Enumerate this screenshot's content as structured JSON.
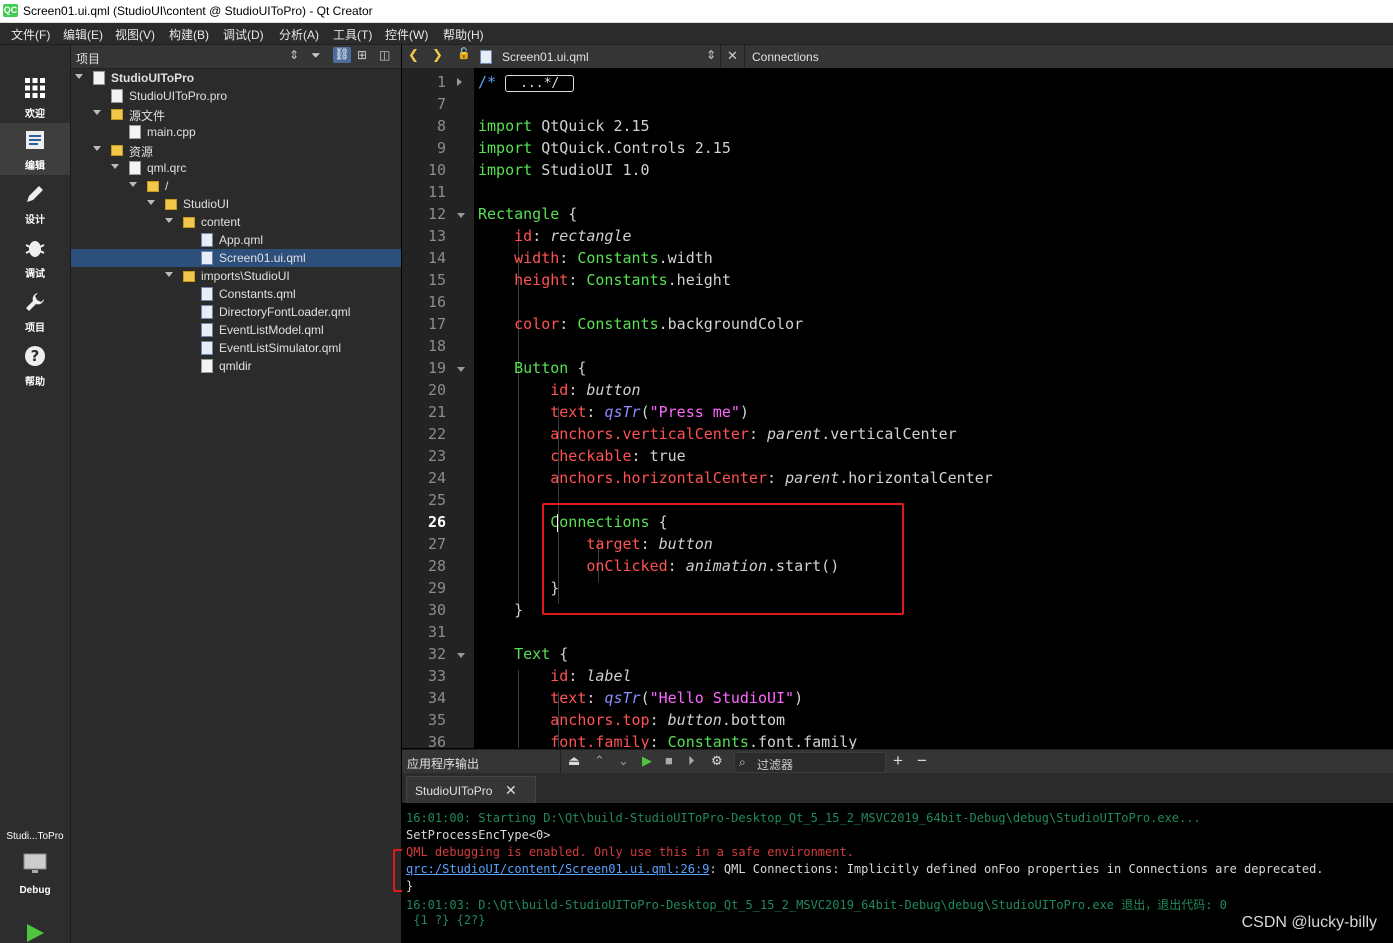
{
  "window": {
    "title": "Screen01.ui.qml (StudioUI\\content @ StudioUIToPro) - Qt Creator",
    "logo": "QC"
  },
  "menu": [
    "文件(F)",
    "编辑(E)",
    "视图(V)",
    "构建(B)",
    "调试(D)",
    "分析(A)",
    "工具(T)",
    "控件(W)",
    "帮助(H)"
  ],
  "modes": [
    {
      "label": "欢迎",
      "icon": "grid-icon"
    },
    {
      "label": "编辑",
      "icon": "edit-doc-icon"
    },
    {
      "label": "设计",
      "icon": "pencil-icon"
    },
    {
      "label": "调试",
      "icon": "bug-icon"
    },
    {
      "label": "项目",
      "icon": "wrench-icon"
    },
    {
      "label": "帮助",
      "icon": "help-icon"
    }
  ],
  "kit": {
    "project": "Studi...ToPro",
    "config": "Debug"
  },
  "project_pane": {
    "title": "项目",
    "tree": [
      {
        "label": "StudioUIToPro",
        "type": "project",
        "expanded": true
      },
      {
        "label": "StudioUIToPro.pro",
        "type": "file"
      },
      {
        "label": "源文件",
        "type": "folder",
        "expanded": true
      },
      {
        "label": "main.cpp",
        "type": "file"
      },
      {
        "label": "资源",
        "type": "folder",
        "expanded": true
      },
      {
        "label": "qml.qrc",
        "type": "file",
        "expanded": true
      },
      {
        "label": "/",
        "type": "folder",
        "expanded": true
      },
      {
        "label": "StudioUI",
        "type": "folder",
        "expanded": true
      },
      {
        "label": "content",
        "type": "folder",
        "expanded": true
      },
      {
        "label": "App.qml",
        "type": "qml"
      },
      {
        "label": "Screen01.ui.qml",
        "type": "qml",
        "selected": true
      },
      {
        "label": "imports\\StudioUI",
        "type": "folder",
        "expanded": true
      },
      {
        "label": "Constants.qml",
        "type": "qml"
      },
      {
        "label": "DirectoryFontLoader.qml",
        "type": "qml"
      },
      {
        "label": "EventListModel.qml",
        "type": "qml"
      },
      {
        "label": "EventListSimulator.qml",
        "type": "qml"
      },
      {
        "label": "qmldir",
        "type": "file"
      }
    ]
  },
  "editor": {
    "file_tab": "Screen01.ui.qml",
    "symbol": "Connections",
    "current_line": "26",
    "line_numbers": [
      "1",
      "7",
      "8",
      "9",
      "10",
      "11",
      "12",
      "13",
      "14",
      "15",
      "16",
      "17",
      "18",
      "19",
      "20",
      "21",
      "22",
      "23",
      "24",
      "25",
      "26",
      "27",
      "28",
      "29",
      "30",
      "31",
      "32",
      "33",
      "34",
      "35",
      "36"
    ],
    "lines": [
      {
        "tokens": [
          [
            "cm",
            "/* "
          ],
          [
            "fold",
            "...*/"
          ]
        ]
      },
      {
        "tokens": []
      },
      {
        "tokens": [
          [
            "ty",
            "import"
          ],
          [
            "kw",
            " QtQuick 2.15"
          ]
        ]
      },
      {
        "tokens": [
          [
            "ty",
            "import"
          ],
          [
            "kw",
            " QtQuick.Controls 2.15"
          ]
        ]
      },
      {
        "tokens": [
          [
            "ty",
            "import"
          ],
          [
            "kw",
            " StudioUI 1.0"
          ]
        ]
      },
      {
        "tokens": []
      },
      {
        "tokens": [
          [
            "ty",
            "Rectangle"
          ],
          [
            "kw",
            " {"
          ]
        ]
      },
      {
        "tokens": [
          [
            "kw",
            "    "
          ],
          [
            "pr",
            "id"
          ],
          [
            "kw",
            ": "
          ],
          [
            "it",
            "rectangle"
          ]
        ]
      },
      {
        "tokens": [
          [
            "kw",
            "    "
          ],
          [
            "pr",
            "width"
          ],
          [
            "kw",
            ": "
          ],
          [
            "ty",
            "Constants"
          ],
          [
            "kw",
            ".width"
          ]
        ]
      },
      {
        "tokens": [
          [
            "kw",
            "    "
          ],
          [
            "pr",
            "height"
          ],
          [
            "kw",
            ": "
          ],
          [
            "ty",
            "Constants"
          ],
          [
            "kw",
            ".height"
          ]
        ]
      },
      {
        "tokens": []
      },
      {
        "tokens": [
          [
            "kw",
            "    "
          ],
          [
            "pr",
            "color"
          ],
          [
            "kw",
            ": "
          ],
          [
            "ty",
            "Constants"
          ],
          [
            "kw",
            ".backgroundColor"
          ]
        ]
      },
      {
        "tokens": []
      },
      {
        "tokens": [
          [
            "kw",
            "    "
          ],
          [
            "ty",
            "Button"
          ],
          [
            "kw",
            " {"
          ]
        ]
      },
      {
        "tokens": [
          [
            "kw",
            "        "
          ],
          [
            "pr",
            "id"
          ],
          [
            "kw",
            ": "
          ],
          [
            "it",
            "button"
          ]
        ]
      },
      {
        "tokens": [
          [
            "kw",
            "        "
          ],
          [
            "pr",
            "text"
          ],
          [
            "kw",
            ": "
          ],
          [
            "fn",
            "qsTr"
          ],
          [
            "kw",
            "("
          ],
          [
            "st",
            "\"Press me\""
          ],
          [
            "kw",
            ")"
          ]
        ]
      },
      {
        "tokens": [
          [
            "kw",
            "        "
          ],
          [
            "pr",
            "anchors.verticalCenter"
          ],
          [
            "kw",
            ": "
          ],
          [
            "it",
            "parent"
          ],
          [
            "kw",
            ".verticalCenter"
          ]
        ]
      },
      {
        "tokens": [
          [
            "kw",
            "        "
          ],
          [
            "pr",
            "checkable"
          ],
          [
            "kw",
            ": true"
          ]
        ]
      },
      {
        "tokens": [
          [
            "kw",
            "        "
          ],
          [
            "pr",
            "anchors.horizontalCenter"
          ],
          [
            "kw",
            ": "
          ],
          [
            "it",
            "parent"
          ],
          [
            "kw",
            ".horizontalCenter"
          ]
        ]
      },
      {
        "tokens": []
      },
      {
        "tokens": [
          [
            "kw",
            "        "
          ],
          [
            "ty",
            "Connections"
          ],
          [
            "kw",
            " {"
          ]
        ]
      },
      {
        "tokens": [
          [
            "kw",
            "            "
          ],
          [
            "pr",
            "target"
          ],
          [
            "kw",
            ": "
          ],
          [
            "it",
            "button"
          ]
        ]
      },
      {
        "tokens": [
          [
            "kw",
            "            "
          ],
          [
            "pr",
            "onClicked"
          ],
          [
            "kw",
            ": "
          ],
          [
            "it",
            "animation"
          ],
          [
            "kw",
            ".start()"
          ]
        ]
      },
      {
        "tokens": [
          [
            "kw",
            "        }"
          ]
        ]
      },
      {
        "tokens": [
          [
            "kw",
            "    }"
          ]
        ]
      },
      {
        "tokens": []
      },
      {
        "tokens": [
          [
            "kw",
            "    "
          ],
          [
            "ty",
            "Text"
          ],
          [
            "kw",
            " {"
          ]
        ]
      },
      {
        "tokens": [
          [
            "kw",
            "        "
          ],
          [
            "pr",
            "id"
          ],
          [
            "kw",
            ": "
          ],
          [
            "it",
            "label"
          ]
        ]
      },
      {
        "tokens": [
          [
            "kw",
            "        "
          ],
          [
            "pr",
            "text"
          ],
          [
            "kw",
            ": "
          ],
          [
            "fn",
            "qsTr"
          ],
          [
            "kw",
            "("
          ],
          [
            "st",
            "\"Hello StudioUI\""
          ],
          [
            "kw",
            ")"
          ]
        ]
      },
      {
        "tokens": [
          [
            "kw",
            "        "
          ],
          [
            "pr",
            "anchors.top"
          ],
          [
            "kw",
            ": "
          ],
          [
            "it",
            "button"
          ],
          [
            "kw",
            ".bottom"
          ]
        ]
      },
      {
        "tokens": [
          [
            "kw",
            "        "
          ],
          [
            "pr",
            "font.family"
          ],
          [
            "kw",
            ": "
          ],
          [
            "ty",
            "Constants"
          ],
          [
            "kw",
            ".font.family"
          ]
        ]
      }
    ]
  },
  "output": {
    "title": "应用程序输出",
    "filter_placeholder": "过滤器",
    "tab": "StudioUIToPro",
    "lines": [
      {
        "color": "#1f8a5a",
        "text": "16:01:00: Starting D:\\Qt\\build-StudioUIToPro-Desktop_Qt_5_15_2_MSVC2019_64bit-Debug\\debug\\StudioUIToPro.exe..."
      },
      {
        "color": "#d8d8d8",
        "text": "SetProcessEncType<0>"
      },
      {
        "color": "#d23c3c",
        "text": "QML debugging is enabled. Only use this in a safe environment."
      },
      {
        "color": "#d8d8d8",
        "link": "qrc:/StudioUI/content/Screen01.ui.qml:26:9",
        "text": ": QML Connections: Implicitly defined onFoo properties in Connections are deprecated."
      },
      {
        "color": "#d8d8d8",
        "text": "}"
      },
      {
        "color": "#1f8a5a",
        "text": "16:01:03: D:\\Qt\\build-StudioUIToPro-Desktop_Qt_5_15_2_MSVC2019_64bit-Debug\\debug\\StudioUIToPro.exe 退出，退出代码: 0"
      },
      {
        "color": "#1f8a5a",
        "text": " {1 ?} {2?}"
      }
    ]
  },
  "watermark": "CSDN @lucky-billy",
  "colors": {
    "highlight_box": "#e01a1a",
    "selection": "#2c4f7c"
  }
}
